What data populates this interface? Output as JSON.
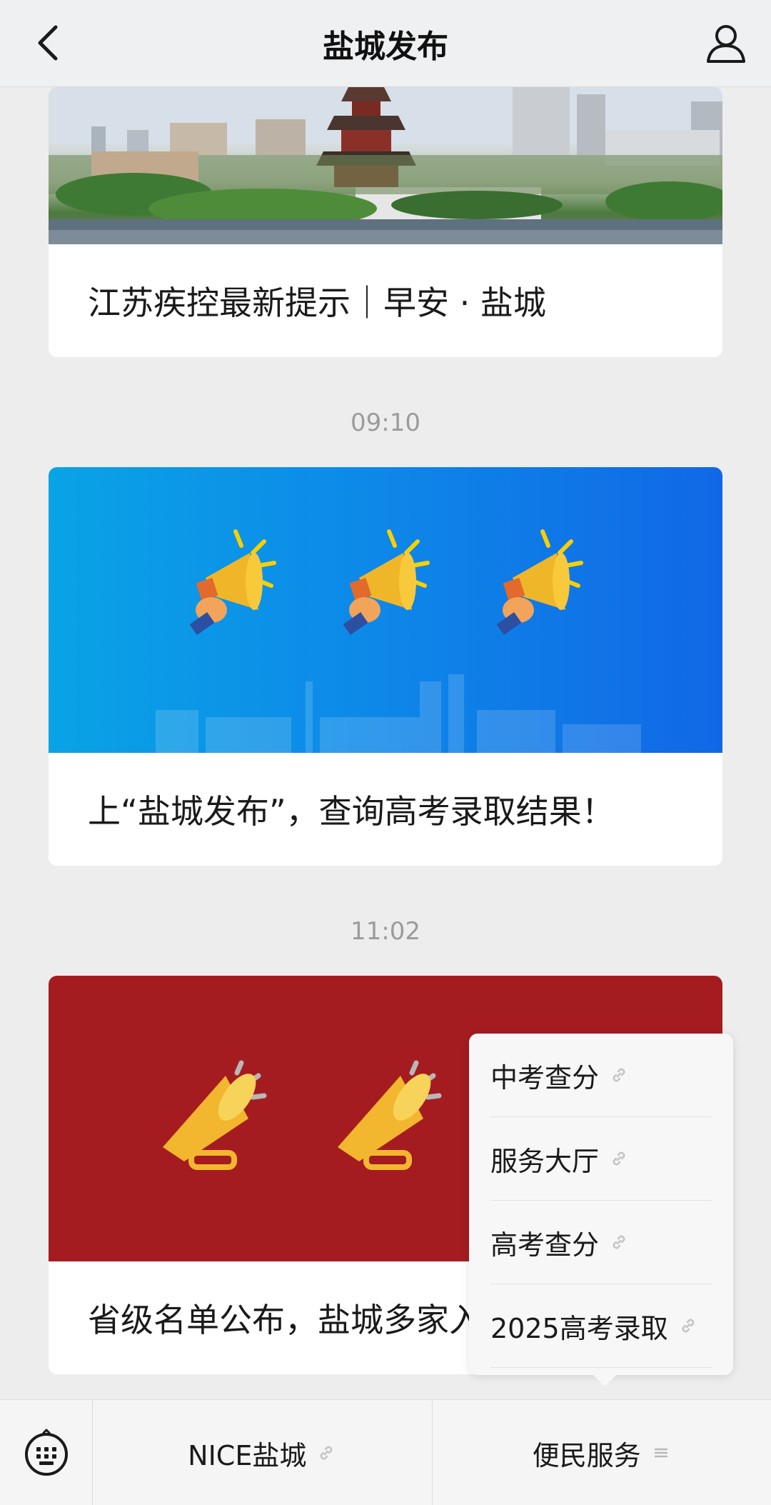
{
  "header": {
    "title": "盐城发布"
  },
  "feed": {
    "articles": [
      {
        "caption": "江苏疾控最新提示｜早安 · 盐城"
      },
      {
        "caption": "上“盐城发布”，查询高考录取结果！"
      },
      {
        "caption": "省级名单公布，盐城多家入选"
      }
    ],
    "timestamps": [
      "09:10",
      "11:02"
    ]
  },
  "submenu": {
    "items": [
      {
        "label": "中考查分"
      },
      {
        "label": "服务大厅"
      },
      {
        "label": "高考查分"
      },
      {
        "label": "2025高考录取"
      }
    ]
  },
  "bottom_bar": {
    "menus": [
      {
        "label": "NICE盐城"
      },
      {
        "label": "便民服务"
      }
    ]
  },
  "icons": {
    "back": "chevron-left-icon",
    "profile": "person-icon",
    "keyboard": "keyboard-icon",
    "link": "link-icon",
    "menu": "menu-lines-icon",
    "megaphone": "megaphone-icon"
  },
  "colors": {
    "banner_blue": "#0d8ae8",
    "banner_red": "#a51c20",
    "timestamp": "#9b9b9b"
  }
}
